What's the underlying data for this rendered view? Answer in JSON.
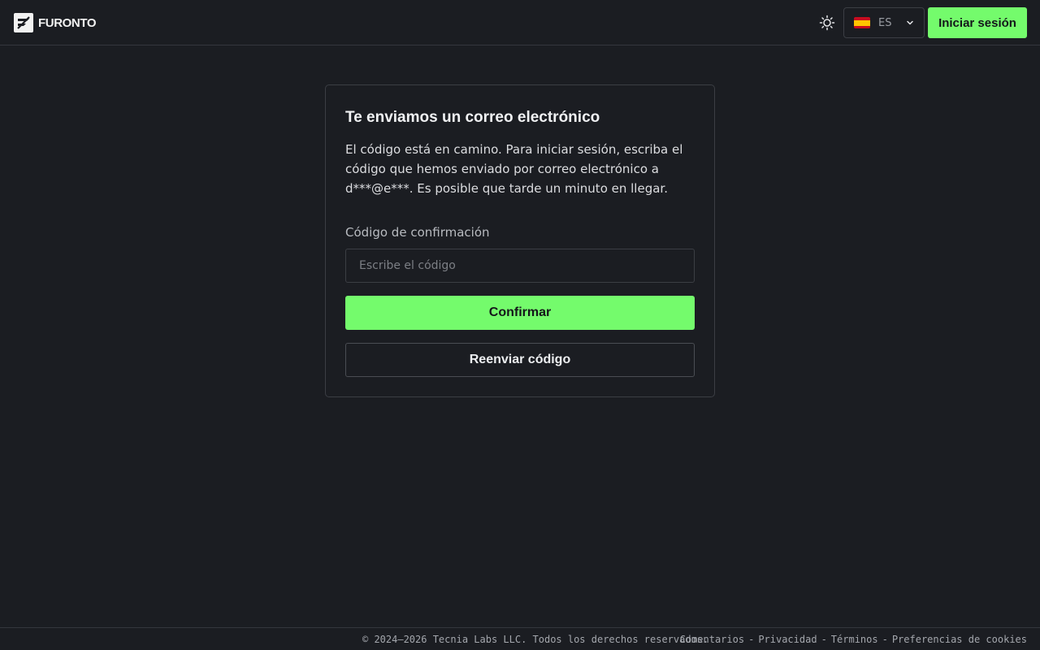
{
  "header": {
    "brand": "FURONTO",
    "language": {
      "code": "ES",
      "flag": "spain-flag-icon"
    },
    "signin_label": "Iniciar sesión",
    "theme_icon": "sun-icon"
  },
  "card": {
    "title": "Te enviamos un correo electrónico",
    "description": "El código está en camino. Para iniciar sesión, escriba el código que hemos enviado por correo electrónico a d***@e***. Es posible que tarde un minuto en llegar.",
    "field_label": "Código de confirmación",
    "code_placeholder": "Escribe el código",
    "code_value": "",
    "confirm_label": "Confirmar",
    "resend_label": "Reenviar código"
  },
  "footer": {
    "copyright": "© 2024–2026 Tecnia Labs LLC. Todos los derechos reservados.",
    "links": {
      "feedback": "Comentarios",
      "privacy": "Privacidad",
      "terms": "Términos",
      "cookies": "Preferencias de cookies"
    },
    "separator": "-"
  },
  "colors": {
    "background": "#1b1d22",
    "accent": "#74fb6c",
    "border": "#3b3e44"
  }
}
